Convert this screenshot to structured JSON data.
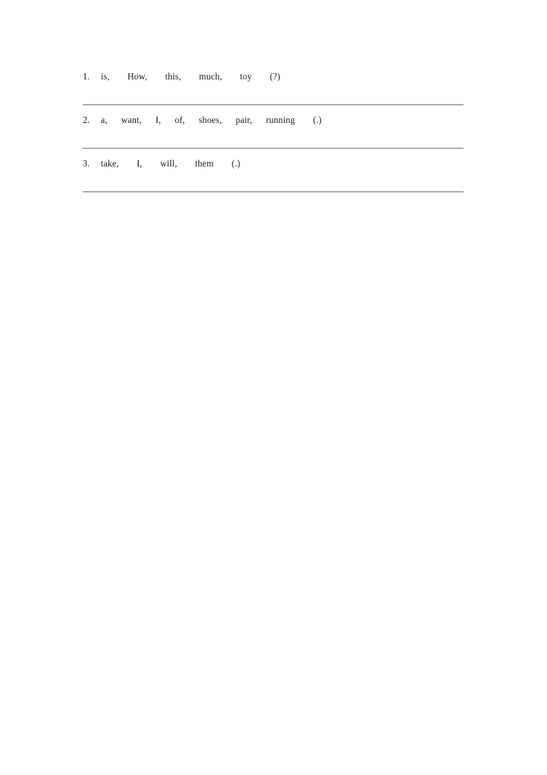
{
  "document": {
    "type": "worksheet",
    "page_background": "#ffffff",
    "text_color": "#1a1a1a",
    "rule_color": "#7d7d7d"
  },
  "exercises": [
    {
      "number": "1.",
      "words": [
        "is,",
        "How,",
        "this,",
        "much,",
        "toy"
      ],
      "punctuation": "(?)",
      "full_text": "1. is,    How,    this,    much,    toy    (?)"
    },
    {
      "number": "2.",
      "words": [
        "a,",
        "want,",
        "I,",
        "of,",
        "shoes,",
        "pair,",
        "running"
      ],
      "punctuation": "(.)",
      "full_text": "2. a,    want,    I,    of,    shoes,    pair,    running    (.)"
    },
    {
      "number": "3.",
      "words": [
        "take,",
        "I,",
        "will,",
        "them"
      ],
      "punctuation": "(.)",
      "full_text": "3. take,    I,    will,    them    (.)"
    }
  ]
}
